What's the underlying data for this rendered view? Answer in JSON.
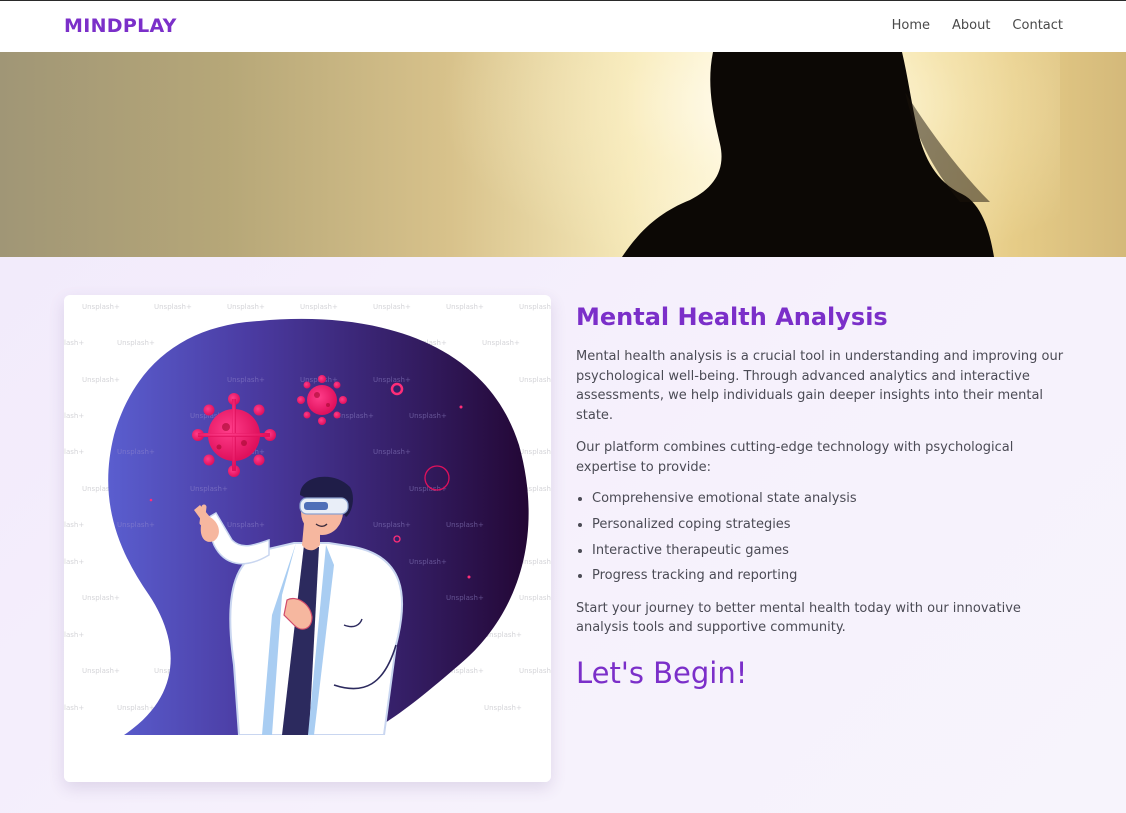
{
  "brand": "MINDPLAY",
  "nav": {
    "items": [
      {
        "label": "Home"
      },
      {
        "label": "About"
      },
      {
        "label": "Contact"
      }
    ]
  },
  "hero": {
    "image": "woman-silhouette-sunset"
  },
  "illustration": {
    "image": "scientist-vr-virus-illustration",
    "watermark": "Unsplash+"
  },
  "content": {
    "title": "Mental Health Analysis",
    "para1": "Mental health analysis is a crucial tool in understanding and improving our psychological well-being. Through advanced analytics and interactive assessments, we help individuals gain deeper insights into their mental state.",
    "para2": "Our platform combines cutting-edge technology with psychological expertise to provide:",
    "features": [
      "Comprehensive emotional state analysis",
      "Personalized coping strategies",
      "Interactive therapeutic games",
      "Progress tracking and reporting"
    ],
    "para3": "Start your journey to better mental health today with our innovative analysis tools and supportive community.",
    "cta": "Let's Begin!"
  },
  "colors": {
    "brand": "#7b2fc9",
    "background": "#f3ecfb",
    "text": "#4b4b55"
  }
}
